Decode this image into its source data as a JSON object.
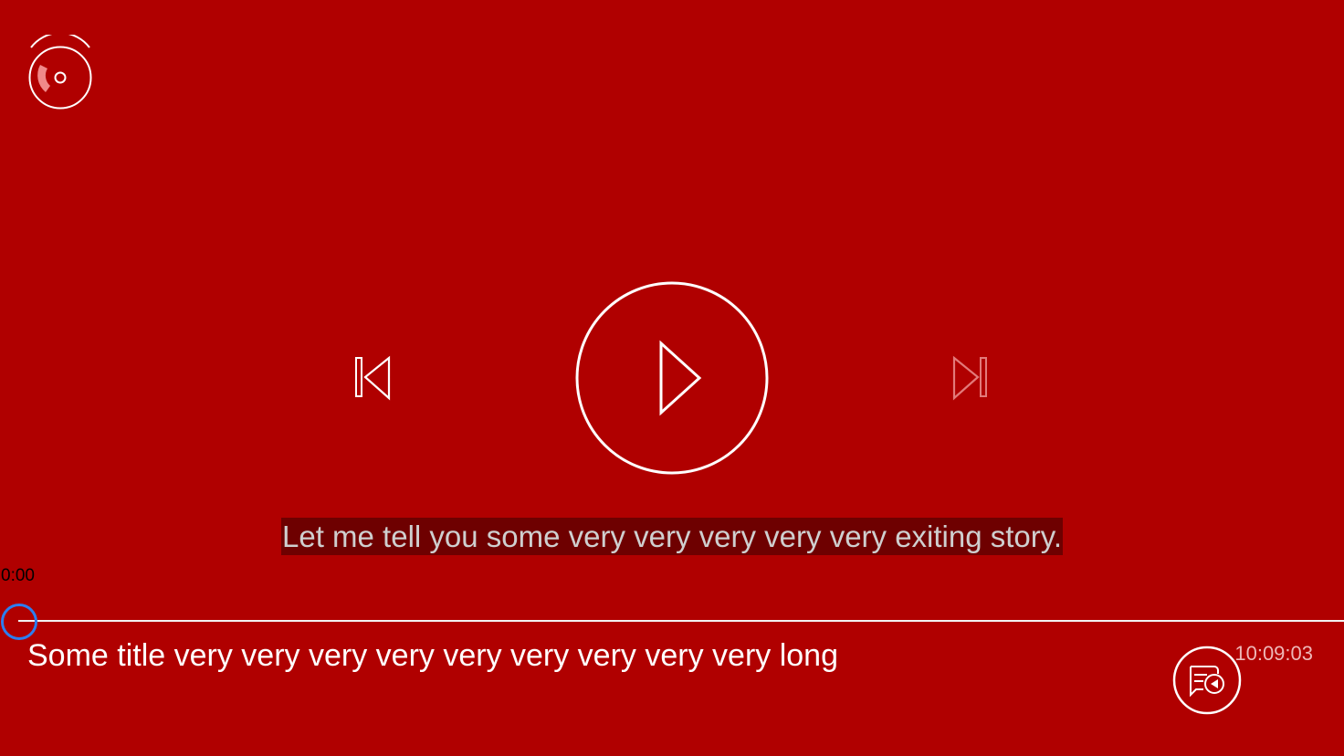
{
  "player": {
    "subtitle": "Let me tell you some very very very very very exiting story.",
    "current_time": "0:00",
    "total_time": "10:09:03",
    "title": "Some title very very very very very very very very very long",
    "progress": 0
  },
  "icons": {
    "top_left": "disc-signal-icon",
    "previous": "skip-previous-icon",
    "play": "play-icon",
    "next": "skip-next-icon",
    "bottom_right": "subtitle-audio-icon"
  },
  "colors": {
    "background": "#b00000",
    "subtitle_bg": "#6e0000",
    "slider_thumb": "#2c7ef0",
    "next_disabled": "#e27a7a"
  }
}
